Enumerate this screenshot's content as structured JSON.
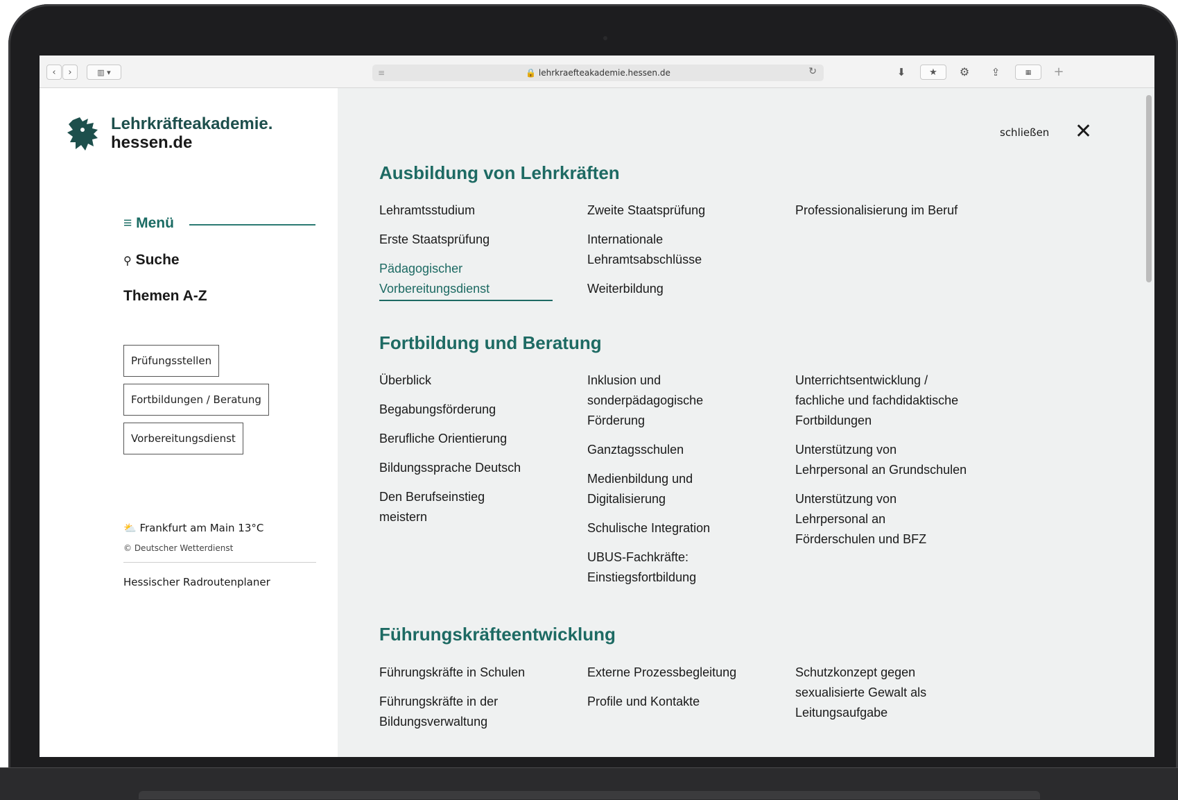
{
  "browser": {
    "url": "lehrkraefteakademie.hessen.de"
  },
  "logo": {
    "line1": "Lehrkräfteakademie.",
    "line2": "hessen.de"
  },
  "sidebar": {
    "menu_label": "≡ Menü",
    "search_label": "Suche",
    "topics_label": "Themen A-Z",
    "buttons": [
      "Prüfungsstellen",
      "Fortbildungen / Beratung",
      "Vorbereitungsdienst"
    ],
    "weather": "Frankfurt am Main  13°C",
    "weather_source": "© Deutscher Wetterdienst",
    "bottom_link": "Hessischer Radroutenplaner"
  },
  "close_label": "schließen",
  "sections": [
    {
      "title": "Ausbildung von Lehrkräften",
      "columns": [
        [
          "Lehramtsstudium",
          "Erste Staatsprüfung",
          "Pädagogischer Vorbereitungsdienst"
        ],
        [
          "Zweite Staatsprüfung",
          "Internationale Lehramtsabschlüsse",
          "Weiterbildung"
        ],
        [
          "Professionalisierung im Beruf"
        ]
      ]
    },
    {
      "title": "Fortbildung und Beratung",
      "columns": [
        [
          "Überblick",
          "Begabungsförderung",
          "Berufliche Orientierung",
          "Bildungssprache Deutsch",
          "Den Berufseinstieg meistern"
        ],
        [
          "Inklusion und sonderpädagogische Förderung",
          "Ganztagsschulen",
          "Medienbildung und Digitalisierung",
          "Schulische Integration",
          "UBUS-Fachkräfte: Einstiegsfortbildung"
        ],
        [
          "Unterrichtsentwicklung / fachliche und fachdidaktische Fortbildungen",
          "Unterstützung von Lehrpersonal an Grundschulen",
          "Unterstützung von Lehrpersonal an Förderschulen und BFZ"
        ]
      ]
    },
    {
      "title": "Führungskräfteentwicklung",
      "columns": [
        [
          "Führungskräfte in Schulen",
          "Führungskräfte in der Bildungsverwaltung"
        ],
        [
          "Externe Prozessbegleitung",
          "Profile und Kontakte"
        ],
        [
          "Schutzkonzept gegen sexualisierte Gewalt als Leitungsaufgabe"
        ]
      ]
    }
  ],
  "colors": {
    "accent": "#1d6a63",
    "main_bg": "#eff1f1"
  }
}
